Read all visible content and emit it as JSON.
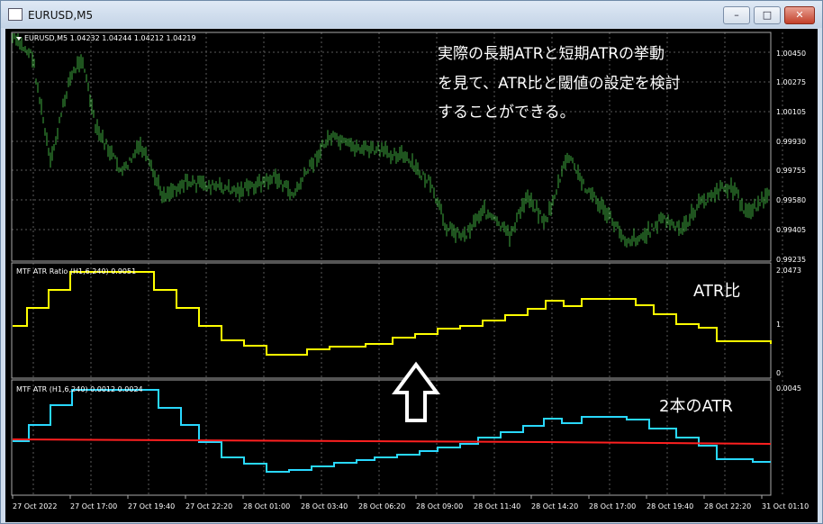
{
  "window": {
    "title": "EURUSD,M5",
    "minimize": "–",
    "maximize": "□",
    "close": "✕",
    "icon": "chart-app-icon"
  },
  "main": {
    "header": "EURUSD,M5  1.04232 1.04244 1.04212 1.04219",
    "y_ticks": [
      "1.00450",
      "1.00275",
      "1.00105",
      "0.99930",
      "0.99755",
      "0.99580",
      "0.99405",
      "0.99235"
    ],
    "annotation": [
      "実際の長期ATRと短期ATRの挙動",
      "を見て、ATR比と閾値の設定を検討",
      "することができる。"
    ]
  },
  "ratio": {
    "header": "MTF ATR Ratio  (H1,6,240) 0.9051",
    "y_ticks": [
      "2.0473",
      "1",
      "0"
    ],
    "label": "ATR比"
  },
  "atr": {
    "header": "MTF ATR  (H1,6,240) 0.0012 0.0024",
    "y_ticks": [
      "0.0045"
    ],
    "label": "2本のATR"
  },
  "x_axis": {
    "labels": [
      "27 Oct 2022",
      "27 Oct 17:00",
      "27 Oct 19:40",
      "27 Oct 22:20",
      "28 Oct 01:00",
      "28 Oct 03:40",
      "28 Oct 06:20",
      "28 Oct 09:00",
      "28 Oct 11:40",
      "28 Oct 14:20",
      "28 Oct 17:00",
      "28 Oct 19:40",
      "28 Oct 22:20",
      "31 Oct 01:10"
    ]
  },
  "colors": {
    "price": "#3ea83e",
    "ratio": "#ffff00",
    "atr_short": "#29d8ff",
    "atr_long": "#ff2020",
    "grid": "#5a5a5a",
    "arrow": "#ffffff"
  }
}
